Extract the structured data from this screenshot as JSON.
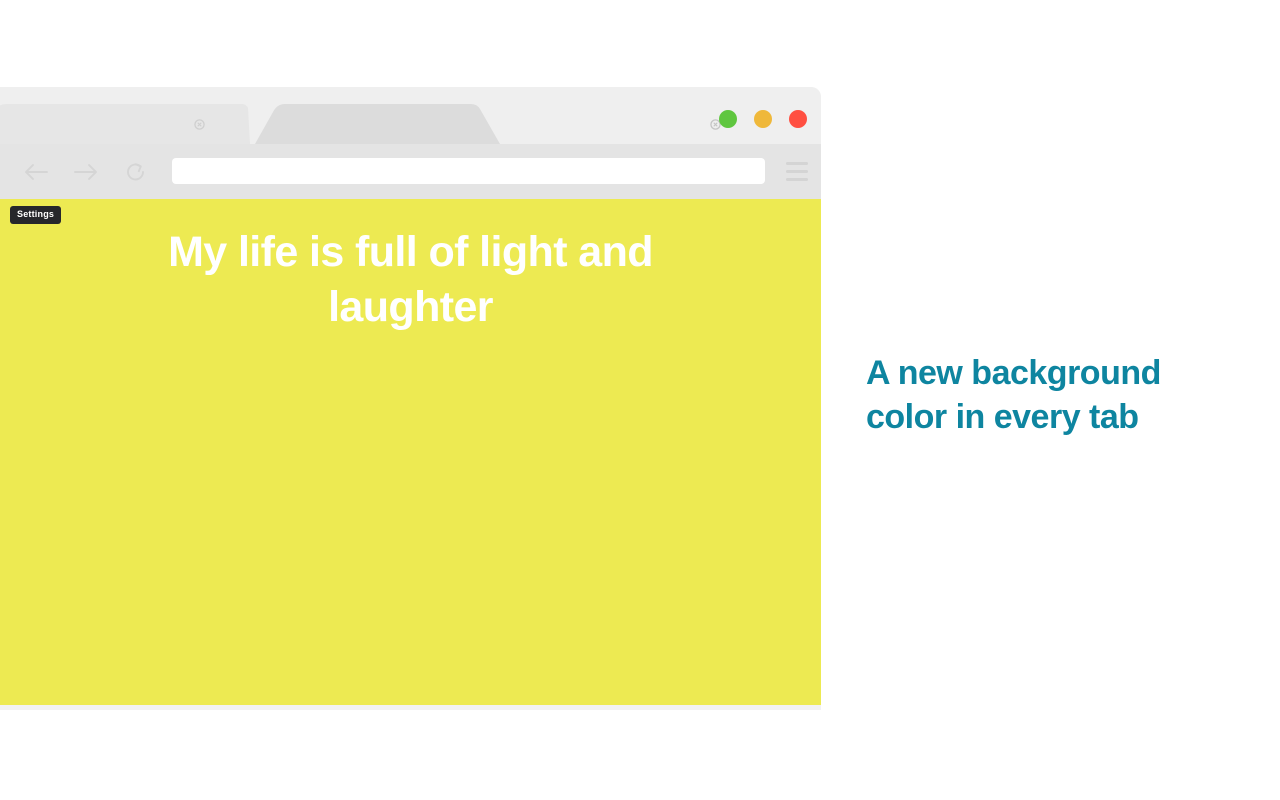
{
  "page": {
    "background_color": "#ffffff"
  },
  "browser": {
    "tabs": [
      {
        "label": "",
        "state": "inactive",
        "close_icon": "close-icon"
      },
      {
        "label": "",
        "state": "active",
        "close_icon": "close-icon"
      }
    ],
    "window_controls": [
      {
        "name": "maximize-button",
        "color": "#5fc63f"
      },
      {
        "name": "minimize-button",
        "color": "#efb83a"
      },
      {
        "name": "close-button",
        "color": "#ff4f41"
      }
    ],
    "toolbar": {
      "back_icon": "arrow-left-icon",
      "forward_icon": "arrow-right-icon",
      "reload_icon": "reload-icon",
      "menu_icon": "hamburger-menu-icon",
      "address": {
        "value": "",
        "placeholder": ""
      }
    },
    "content": {
      "background_color": "#edea52",
      "badge": "Settings",
      "quote": "My life is full of light and laughter",
      "quote_color": "#ffffff"
    }
  },
  "caption": {
    "text": "A new background color in every tab",
    "color": "#0e85a0"
  }
}
